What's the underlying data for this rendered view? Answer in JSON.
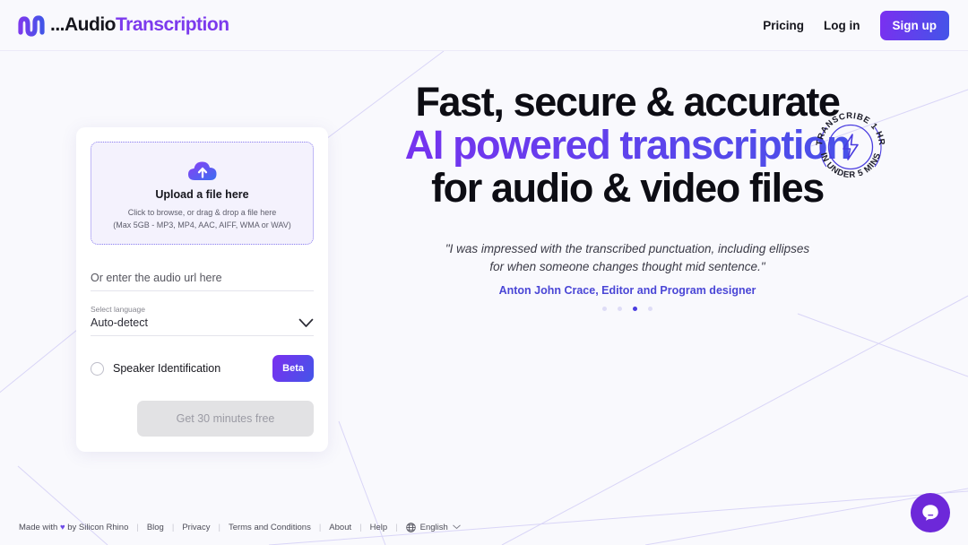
{
  "brand": {
    "logo_icon": "audio-waveform-icon",
    "dots": "...",
    "name_part1": "Audio",
    "name_part2": "Transcription",
    "accent": "#7c3aed"
  },
  "header": {
    "nav": [
      {
        "label": "Pricing",
        "name": "pricing"
      },
      {
        "label": "Log in",
        "name": "login"
      }
    ],
    "signup_label": "Sign up"
  },
  "upload_card": {
    "dropzone": {
      "icon": "cloud-upload-icon",
      "title": "Upload a file here",
      "sub_line1": "Click to browse, or drag & drop a file here",
      "sub_line2": "(Max 5GB - MP3, MP4, AAC, AIFF, WMA or WAV)"
    },
    "url_placeholder": "Or enter the audio url here",
    "url_value": "",
    "language_label": "Select language",
    "language_value": "Auto-detect",
    "chevron_icon": "chevron-down-icon",
    "speaker_label": "Speaker Identification",
    "speaker_checked": false,
    "beta_label": "Beta",
    "cta_label": "Get 30 minutes free",
    "cta_disabled": true
  },
  "hero": {
    "line1": "Fast, secure & accurate",
    "line2": "AI powered transcription",
    "line3": "for audio & video files",
    "quote_line1": "\"I was impressed with the transcribed punctuation, including ellipses",
    "quote_line2": "for when someone changes thought mid sentence.\"",
    "author": "Anton John Crace, Editor and Program designer",
    "carousel_total": 4,
    "carousel_active": 3
  },
  "badge": {
    "top_text": "TRANSCRIBE 1 HR",
    "bottom_text": "IN UNDER 5 MINS",
    "icon": "lightning-bolt-icon",
    "color": "#4a3ce0"
  },
  "footer": {
    "made_with_prefix": "Made with",
    "heart": "♥",
    "made_with_suffix": "by Silicon Rhino",
    "links": [
      {
        "label": "Blog",
        "name": "blog"
      },
      {
        "label": "Privacy",
        "name": "privacy"
      },
      {
        "label": "Terms and Conditions",
        "name": "terms"
      },
      {
        "label": "About",
        "name": "about"
      },
      {
        "label": "Help",
        "name": "help"
      }
    ],
    "separator": "|",
    "globe_icon": "globe-icon",
    "language": "English",
    "lang_chevron": "chevron-down-icon"
  },
  "chat": {
    "icon": "chat-bubble-icon",
    "color": "#6d28d9"
  }
}
